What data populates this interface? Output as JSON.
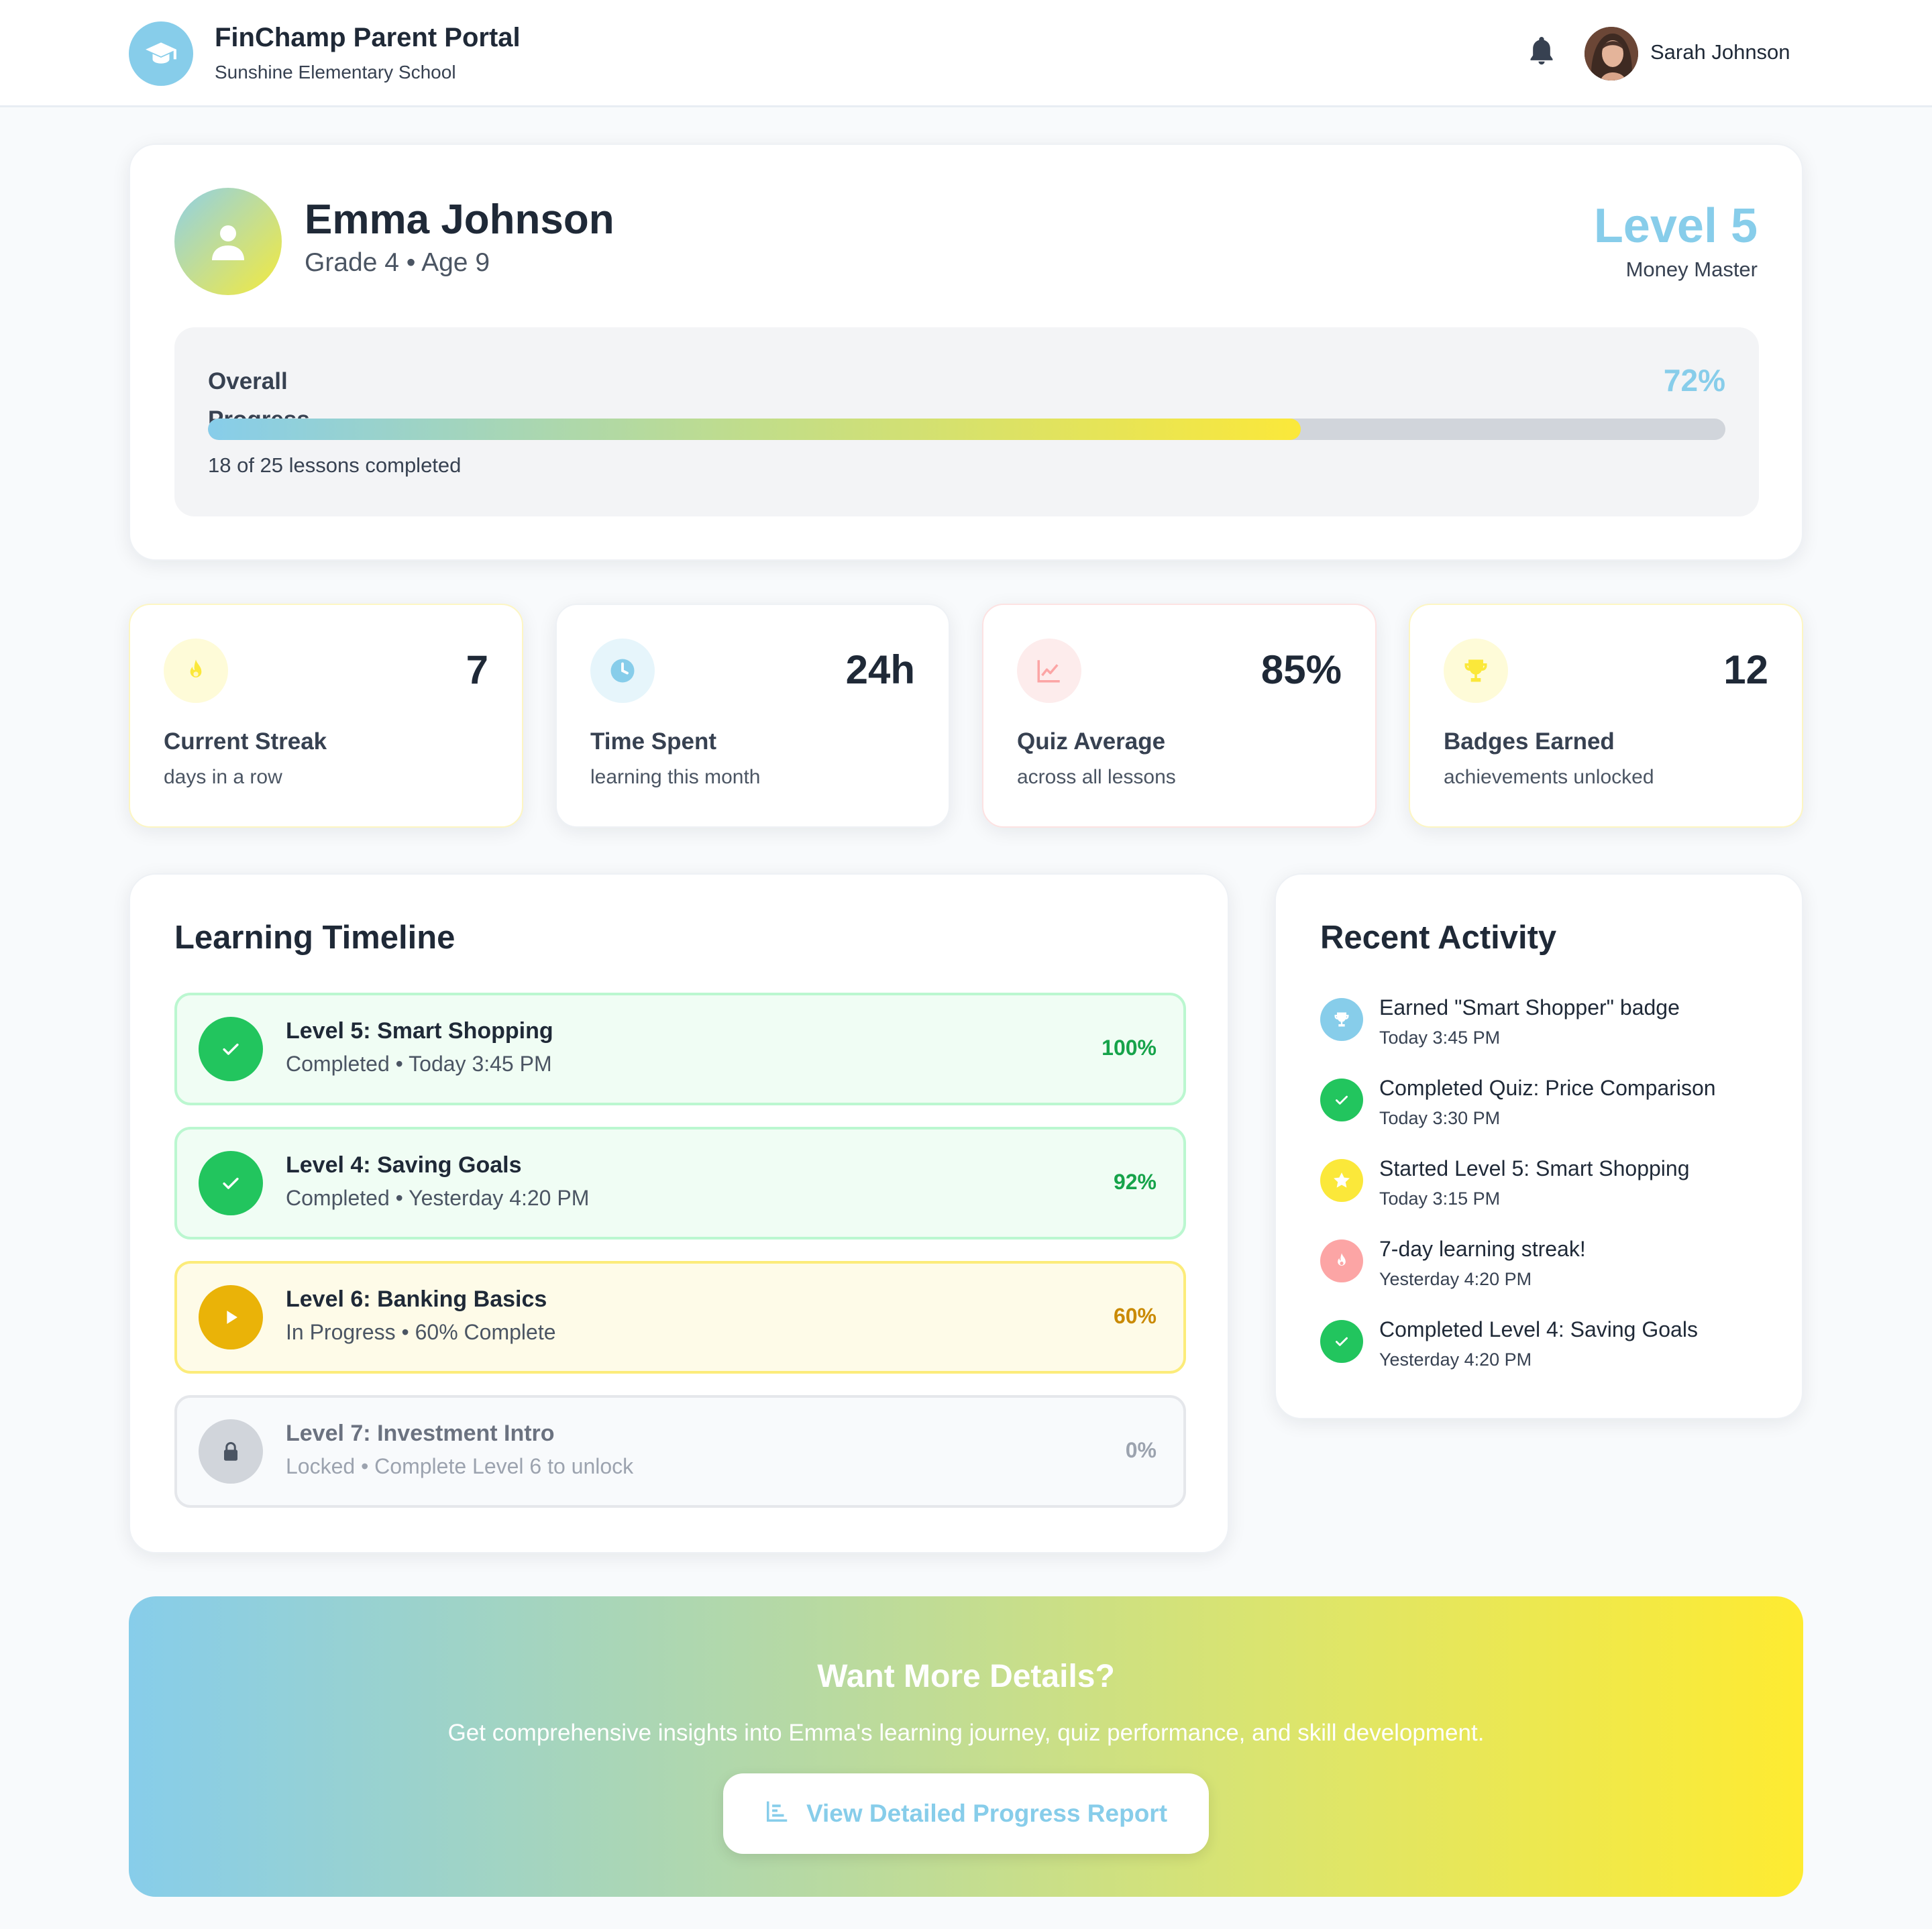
{
  "header": {
    "app_title": "FinChamp Parent Portal",
    "school": "Sunshine Elementary School",
    "user_name": "Sarah Johnson",
    "icons": [
      "graduation-cap-icon",
      "bell-icon"
    ]
  },
  "profile": {
    "name": "Emma Johnson",
    "meta": "Grade 4 • Age 9",
    "level": "Level 5",
    "level_title": "Money Master",
    "progress_label": "Overall Progress",
    "progress_percent_text": "72%",
    "progress_fraction": 0.72,
    "lessons_note": "18 of 25 lessons completed"
  },
  "stats": [
    {
      "icon": "fire-icon",
      "value": "7",
      "label": "Current Streak",
      "sub": "days in a row",
      "color": "#fbe83a"
    },
    {
      "icon": "clock-icon",
      "value": "24h",
      "label": "Time Spent",
      "sub": "learning this month",
      "color": "#87cdea"
    },
    {
      "icon": "chart-line-icon",
      "value": "85%",
      "label": "Quiz Average",
      "sub": "across all lessons",
      "color": "#fca5a5"
    },
    {
      "icon": "trophy-icon",
      "value": "12",
      "label": "Badges Earned",
      "sub": "achievements unlocked",
      "color": "#fbe83a"
    }
  ],
  "timeline": {
    "title": "Learning Timeline",
    "items": [
      {
        "title": "Level 5: Smart Shopping",
        "sub": "Completed • Today 3:45 PM",
        "pct": "100%",
        "status": "completed",
        "icon": "check-icon"
      },
      {
        "title": "Level 4: Saving Goals",
        "sub": "Completed • Yesterday 4:20 PM",
        "pct": "92%",
        "status": "completed",
        "icon": "check-icon"
      },
      {
        "title": "Level 6: Banking Basics",
        "sub": "In Progress • 60% Complete",
        "pct": "60%",
        "status": "in-progress",
        "icon": "play-icon"
      },
      {
        "title": "Level 7: Investment Intro",
        "sub": "Locked • Complete Level 6 to unlock",
        "pct": "0%",
        "status": "locked",
        "icon": "lock-icon"
      }
    ]
  },
  "activity": {
    "title": "Recent Activity",
    "items": [
      {
        "title": "Earned \"Smart Shopper\" badge",
        "time": "Today 3:45 PM",
        "icon": "trophy-icon",
        "color": "#87cdea"
      },
      {
        "title": "Completed Quiz: Price Comparison",
        "time": "Today 3:30 PM",
        "icon": "check-icon",
        "color": "#22c55e"
      },
      {
        "title": "Started Level 5: Smart Shopping",
        "time": "Today 3:15 PM",
        "icon": "star-icon",
        "color": "#fbe83a"
      },
      {
        "title": "7-day learning streak!",
        "time": "Yesterday 4:20 PM",
        "icon": "fire-icon",
        "color": "#fca5a5"
      },
      {
        "title": "Completed Level 4: Saving Goals",
        "time": "Yesterday 4:20 PM",
        "icon": "check-icon",
        "color": "#22c55e"
      }
    ]
  },
  "cta": {
    "title": "Want More Details?",
    "text": "Get comprehensive insights into Emma's learning journey, quiz performance, and skill development.",
    "button_label": "View Detailed Progress Report",
    "button_icon": "chart-bar-icon"
  },
  "colors": {
    "accent_blue": "#87cdea",
    "accent_yellow": "#fbe83a",
    "success": "#22c55e",
    "warning": "#eab308"
  }
}
